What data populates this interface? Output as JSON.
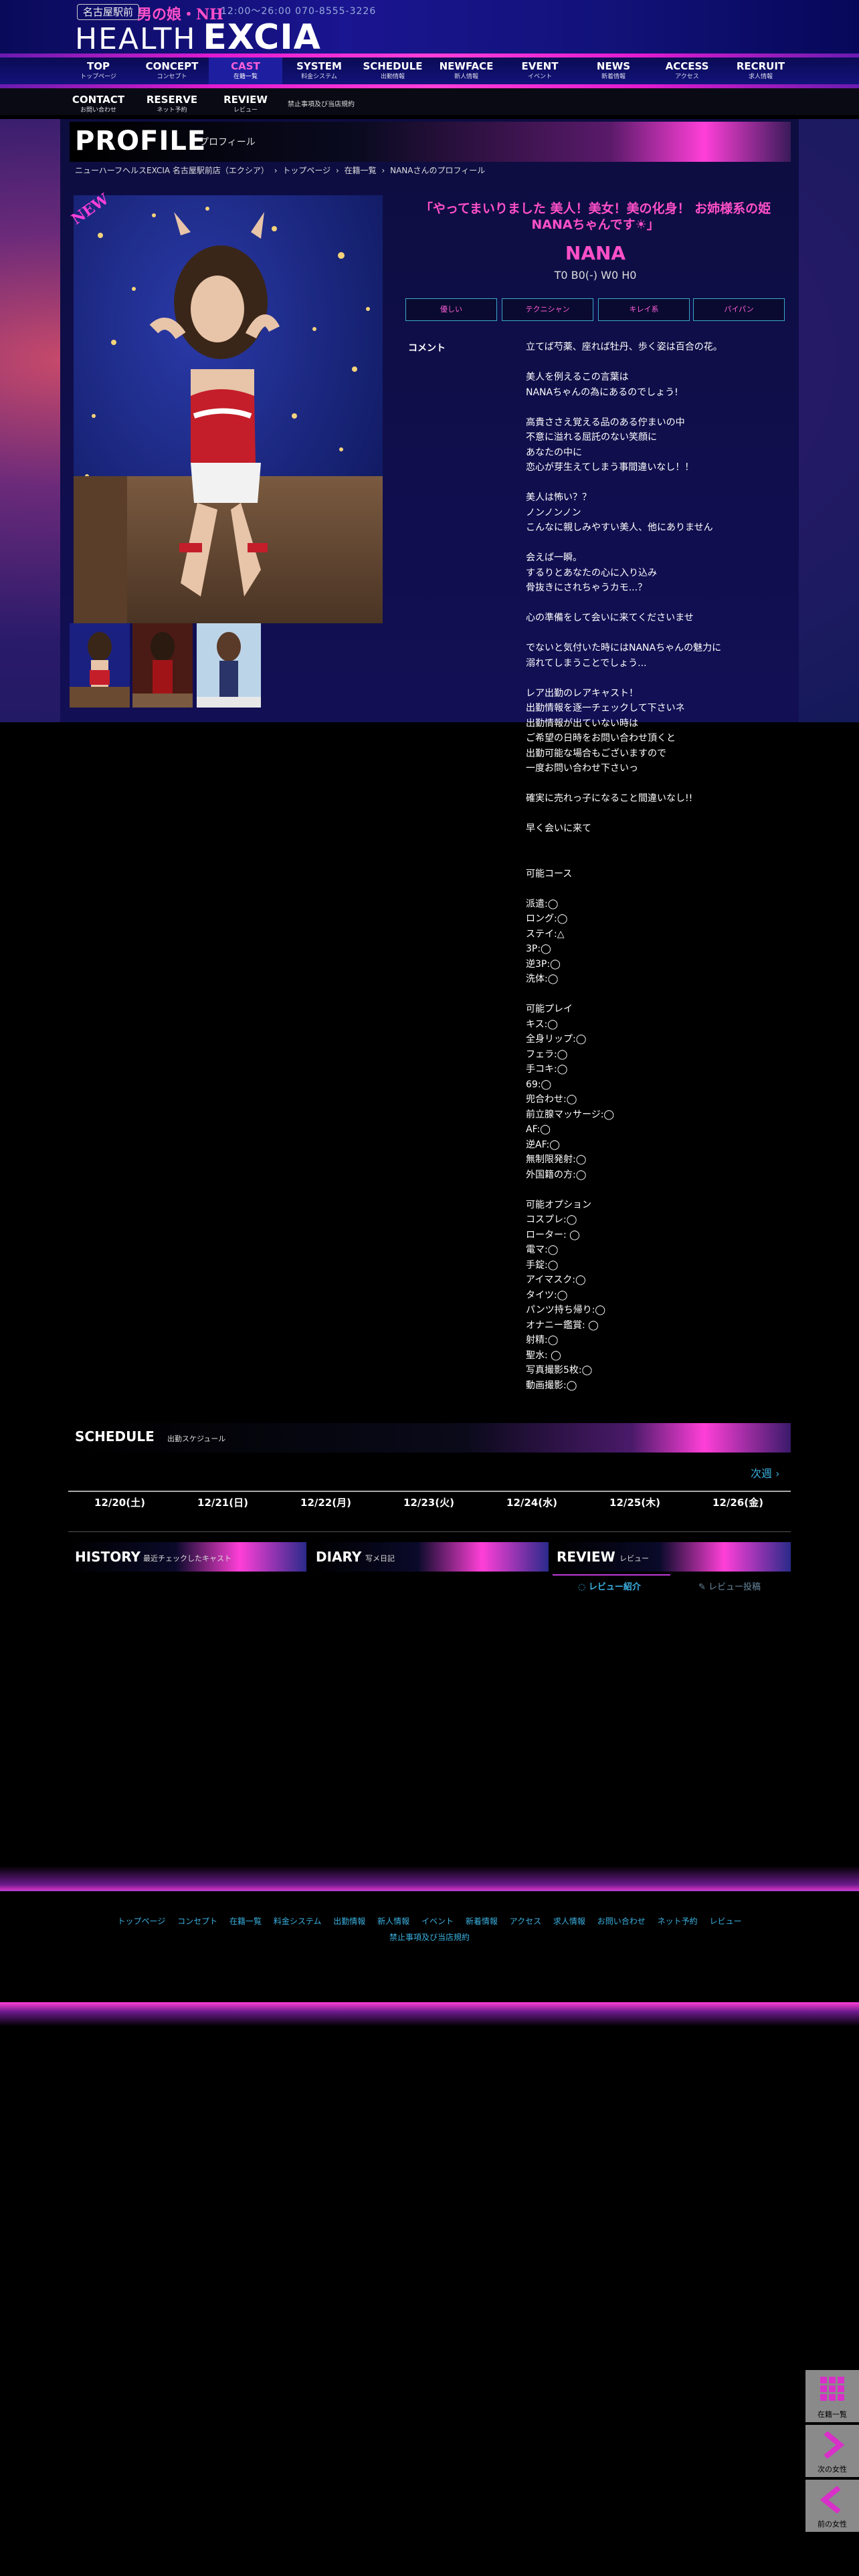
{
  "header": {
    "area_tag": "名古屋駅前",
    "subtitle": "男の娘・NH",
    "hours_tel": "12:00～26:00 070-8555-3226",
    "logo_prefix": "HEALTH",
    "logo_brand": "EXCIA"
  },
  "nav": [
    {
      "en": "TOP",
      "jp": "トップページ"
    },
    {
      "en": "CONCEPT",
      "jp": "コンセプト"
    },
    {
      "en": "CAST",
      "jp": "在籍一覧"
    },
    {
      "en": "SYSTEM",
      "jp": "料金システム"
    },
    {
      "en": "SCHEDULE",
      "jp": "出勤情報"
    },
    {
      "en": "NEWFACE",
      "jp": "新人情報"
    },
    {
      "en": "EVENT",
      "jp": "イベント"
    },
    {
      "en": "NEWS",
      "jp": "新着情報"
    },
    {
      "en": "ACCESS",
      "jp": "アクセス"
    },
    {
      "en": "RECRUIT",
      "jp": "求人情報"
    }
  ],
  "nav2": [
    {
      "en": "CONTACT",
      "jp": "お問い合わせ"
    },
    {
      "en": "RESERVE",
      "jp": "ネット予約"
    },
    {
      "en": "REVIEW",
      "jp": "レビュー"
    }
  ],
  "nav2_rules": "禁止事項及び当店規約",
  "profile": {
    "title": "PROFILE",
    "title_jp": "プロフィール",
    "breadcrumb": [
      "ニューハーフヘルスEXCIA 名古屋駅前店（エクシア）",
      "›",
      "トップページ",
      "›",
      "在籍一覧",
      "›",
      "NANAさんのプロフィール"
    ],
    "new_badge": "NEW",
    "catch": "「やってまいりました 美人！美女！美の化身！ お姉様系の姫 NANAちゃんです☀」",
    "name": "NANA",
    "size": "T0 B0(-) W0 H0",
    "tags": [
      "優しい",
      "テクニシャン",
      "キレイ系",
      "パイパン"
    ],
    "comment_label": "コメント",
    "comment_lines": [
      "立てば芍薬、座れば牡丹、歩く姿は百合の花。",
      "",
      "美人を例えるこの言葉は",
      "NANAちゃんの為にあるのでしょう!",
      "",
      "高貴ささえ覚える品のある佇まいの中",
      "不意に溢れる屈託のない笑顔に",
      "あなたの中に",
      "恋心が芽生えてしまう事間違いなし！！",
      "",
      "美人は怖い？？",
      "ノンノンノン",
      "こんなに親しみやすい美人、他にありません",
      "",
      "会えば一瞬。",
      "するりとあなたの心に入り込み",
      "骨抜きにされちゃうカモ...？",
      "",
      "心の準備をして会いに来てくださいませ",
      "",
      "でないと気付いた時にはNANAちゃんの魅力に",
      "溺れてしまうことでしょう...",
      "",
      "レア出勤のレアキャスト！",
      "出勤情報を逐一チェックして下さいネ",
      "出勤情報が出ていない時は",
      "ご希望の日時をお問い合わせ頂くと",
      "出勤可能な場合もございますので",
      "一度お問い合わせ下さいっ",
      "",
      "確実に売れっ子になること間違いなし!!",
      "",
      "早く会いに来て",
      "",
      "",
      "可能コース",
      "",
      "派遣:◯",
      "ロング:◯",
      "ステイ:△",
      "3P:◯",
      "逆3P:◯",
      "洗体:◯",
      "",
      "可能プレイ",
      "キス:◯",
      "全身リップ:◯",
      "フェラ:◯",
      "手コキ:◯",
      "69:◯",
      "兜合わせ:◯",
      "前立腺マッサージ:◯",
      "AF:◯",
      "逆AF:◯",
      "無制限発射:◯",
      "外国籍の方:◯",
      "",
      "可能オプション",
      "コスプレ:◯",
      "ローター: ◯",
      "電マ:◯",
      "手錠:◯",
      "アイマスク:◯",
      "タイツ:◯",
      "パンツ持ち帰り:◯",
      "オナニー鑑賞: ◯",
      "射精:◯",
      "聖水: ◯",
      "写真撮影5枚:◯",
      "動画撮影:◯"
    ]
  },
  "schedule": {
    "title": "SCHEDULE",
    "title_jp": "出勤スケジュール",
    "next_label": "次週",
    "days": [
      "12/20(土)",
      "12/21(日)",
      "12/22(月)",
      "12/23(火)",
      "12/24(水)",
      "12/25(木)",
      "12/26(金)"
    ]
  },
  "history": {
    "title": "HISTORY",
    "title_jp": "最近チェックしたキャスト"
  },
  "diary": {
    "title": "DIARY",
    "title_jp": "写メ日記"
  },
  "review": {
    "title": "REVIEW",
    "title_jp": "レビュー",
    "tab_intro": "レビュー紹介",
    "tab_post": "レビュー投稿"
  },
  "footer": {
    "links": [
      "トップページ",
      "コンセプト",
      "在籍一覧",
      "料金システム",
      "出勤情報",
      "新人情報",
      "イベント",
      "新着情報",
      "アクセス",
      "求人情報",
      "お問い合わせ",
      "ネット予約",
      "レビュー"
    ],
    "rules": "禁止事項及び当店規約"
  },
  "side": {
    "list": "在籍一覧",
    "next": "次の女性",
    "prev": "前の女性"
  },
  "colors": {
    "accent": "#ff4fc8",
    "link": "#3ab0e0",
    "nav_bg": "#0b0b55"
  }
}
